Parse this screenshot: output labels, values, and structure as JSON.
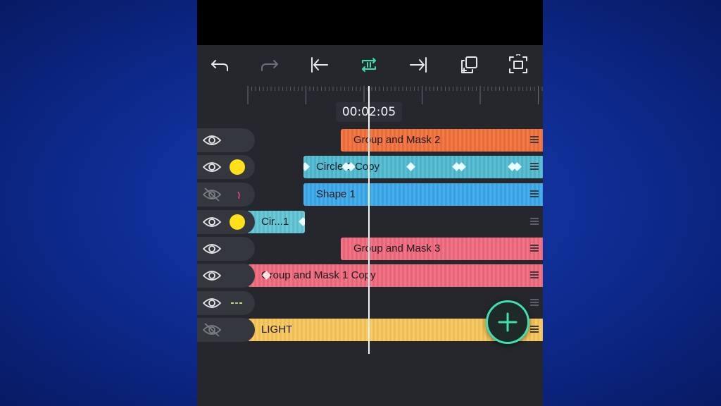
{
  "toolbar": {
    "icons": [
      "undo-icon",
      "redo-icon",
      "skip-to-start-icon",
      "loop-icon",
      "skip-to-end-icon",
      "duplicate-icon",
      "fit-screen-icon"
    ]
  },
  "timeline": {
    "current_time": "00:02:05"
  },
  "tracks": [
    {
      "visible": true,
      "thumbnail": "none",
      "clip_label": "Group and Mask 2",
      "clip_color": "#f2703a"
    },
    {
      "visible": true,
      "thumbnail": "yellow-circle",
      "clip_label": "Circle 1 Copy",
      "clip_color": "#4fb9cf"
    },
    {
      "visible": false,
      "thumbnail": "pink-mark",
      "clip_label": "Shape 1",
      "clip_color": "#3aa8ea"
    },
    {
      "visible": true,
      "thumbnail": "yellow-circle",
      "clip_label": "Cir...1",
      "clip_color": "#5fc4d4"
    },
    {
      "visible": true,
      "thumbnail": "none",
      "clip_label": "Group and Mask 3",
      "clip_color": "#ef6a7c"
    },
    {
      "visible": true,
      "thumbnail": "none",
      "clip_label": "Group and Mask 1 Copy",
      "clip_color": "#ef6a7c"
    },
    {
      "visible": true,
      "thumbnail": "green-text",
      "clip_label": "",
      "clip_color": ""
    },
    {
      "visible": false,
      "thumbnail": "none",
      "clip_label": "LIGHT",
      "clip_color": "#f7c65a"
    }
  ],
  "fab": {
    "icon": "plus-icon"
  }
}
